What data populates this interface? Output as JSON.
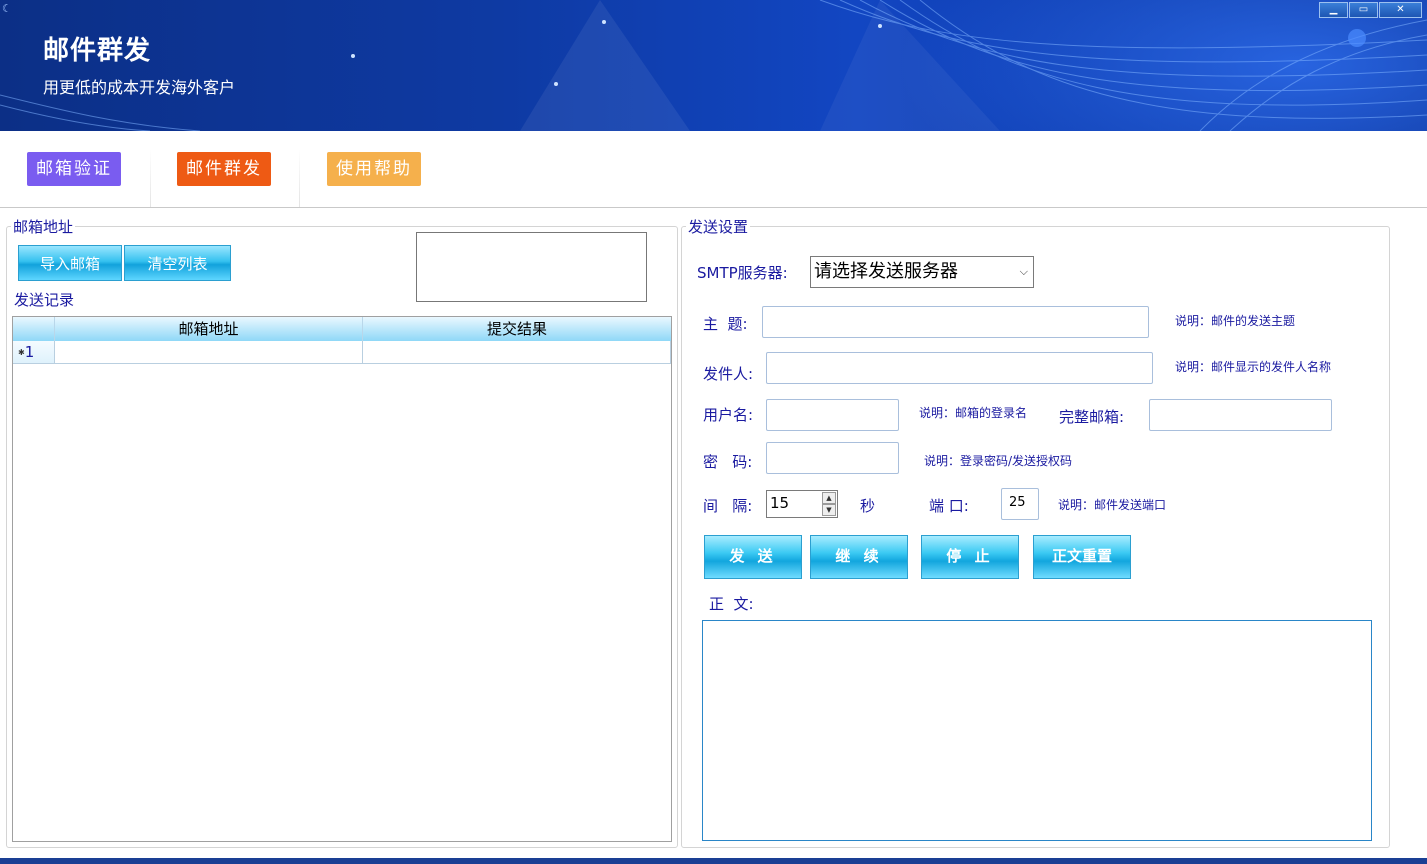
{
  "app": {
    "title": "邮件群发",
    "subtitle": "用更低的成本开发海外客户",
    "window_controls": [
      "minimize-icon",
      "maximize-icon",
      "close-icon"
    ]
  },
  "nav": {
    "items": [
      {
        "label": "邮箱验证",
        "color": "#7a5cf0"
      },
      {
        "label": "邮件群发",
        "color": "#ee5a14"
      },
      {
        "label": "使用帮助",
        "color": "#f5b04c"
      }
    ]
  },
  "left_panel": {
    "group_title": "邮箱地址",
    "import_button": "导入邮箱",
    "clear_button": "清空列表",
    "record_label": "发送记录",
    "table": {
      "columns": [
        "邮箱地址",
        "提交结果"
      ],
      "rows": [
        {
          "row_header": "1",
          "email": "",
          "result": ""
        }
      ]
    }
  },
  "right_panel": {
    "group_title": "发送设置",
    "smtp_label": "SMTP服务器:",
    "smtp_selected": "请选择发送服务器",
    "subject_label": "主  题:",
    "subject_value": "",
    "subject_hint": "说明：邮件的发送主题",
    "sender_label": "发件人:",
    "sender_value": "",
    "sender_hint": "说明：邮件显示的发件人名称",
    "username_label": "用户名:",
    "username_value": "",
    "username_hint": "说明：邮箱的登录名",
    "fullmail_label": "完整邮箱:",
    "fullmail_value": "",
    "password_label": "密   码:",
    "password_value": "",
    "password_hint": "说明：登录密码/发送授权码",
    "interval_label": "间   隔:",
    "interval_value": "15",
    "seconds_label": "秒",
    "port_label": "端 口:",
    "port_value": "25",
    "port_hint": "说明：邮件发送端口",
    "buttons": {
      "send": "发 送",
      "continue": "继 续",
      "stop": "停 止",
      "reset": "正文重置"
    },
    "body_label": "正  文:",
    "body_value": ""
  },
  "colors": {
    "label_text": "#1a1aa0",
    "header_bg": "#0e3aa3",
    "button_cyan": "#12a2dc"
  }
}
